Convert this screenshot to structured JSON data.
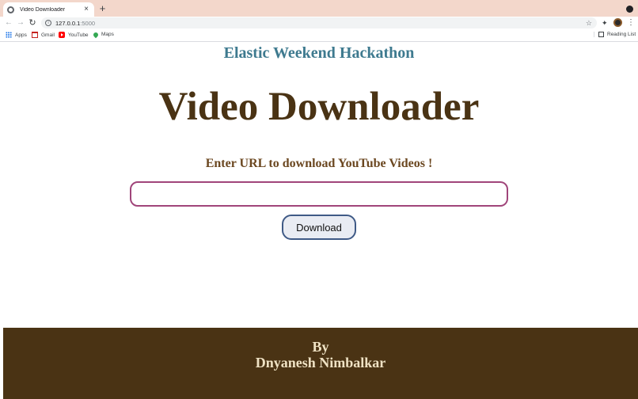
{
  "browser": {
    "tab_title": "Video Downloader",
    "tab_close": "×",
    "new_tab": "+",
    "url_host": "127.0.0.1",
    "url_port": ":5000",
    "bookmarks": [
      {
        "label": "Apps",
        "icon": "apps-icon"
      },
      {
        "label": "Gmail",
        "icon": "gmail-icon"
      },
      {
        "label": "YouTube",
        "icon": "youtube-icon"
      },
      {
        "label": "Maps",
        "icon": "maps-icon"
      }
    ],
    "reading_list": "Reading List"
  },
  "page": {
    "hackathon_title": "Elastic Weekend Hackathon",
    "main_title": "Video Downloader",
    "subtitle": "Enter URL to download YouTube Videos !",
    "url_input": {
      "value": "",
      "placeholder": ""
    },
    "download_label": "Download",
    "footer": {
      "by": "By",
      "name": "Dnyanesh Nimbalkar"
    }
  },
  "colors": {
    "tabstrip": "#f3d7cb",
    "brown": "#4a3314",
    "teal": "#3e7a8f",
    "input_border": "#a0457a",
    "button_border": "#3f5a86",
    "footer_text": "#efe2c4"
  }
}
